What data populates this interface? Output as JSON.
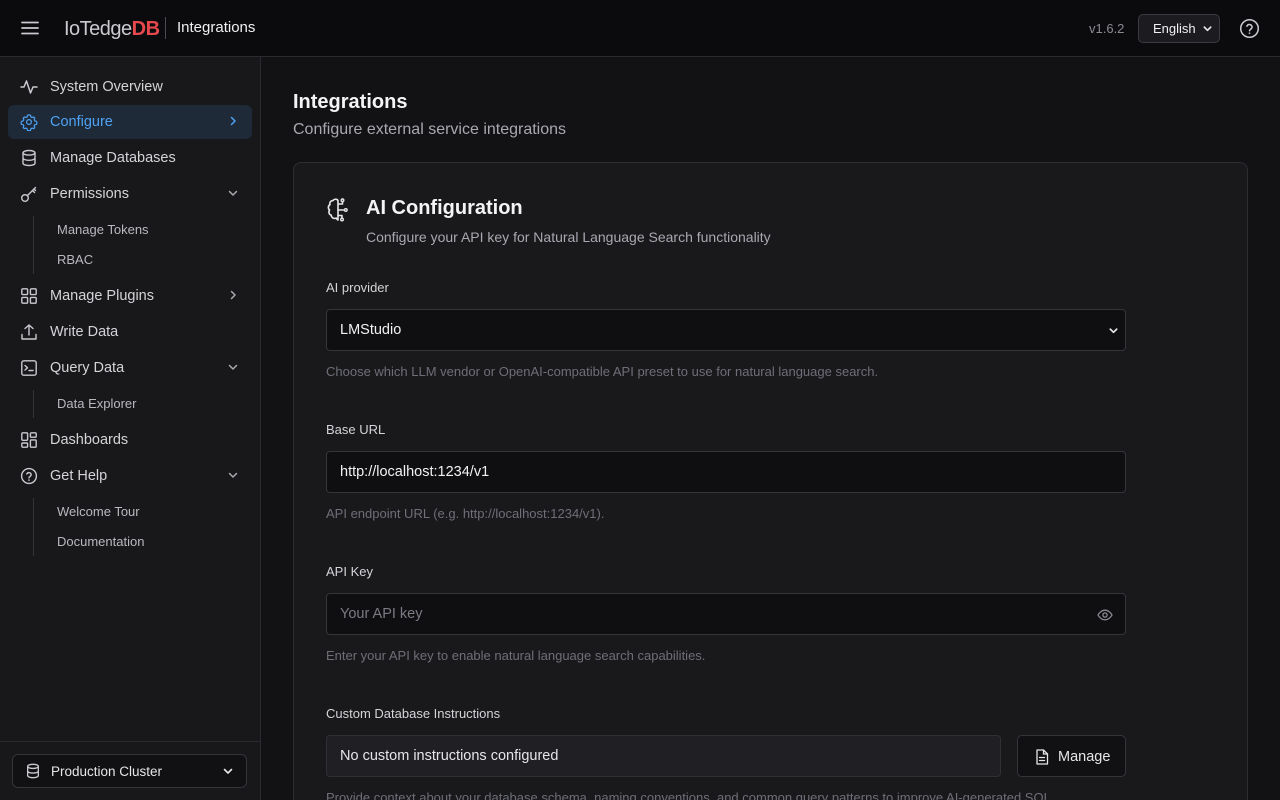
{
  "header": {
    "logo_part1": "IoTedge",
    "logo_part2": "DB",
    "title": "Integrations",
    "version": "v1.6.2",
    "language": "English"
  },
  "sidebar": {
    "items": [
      {
        "label": "System Overview",
        "icon": "activity-icon"
      },
      {
        "label": "Configure",
        "icon": "gear-icon",
        "active": true,
        "chevron": "right"
      },
      {
        "label": "Manage Databases",
        "icon": "database-icon"
      },
      {
        "label": "Permissions",
        "icon": "key-icon",
        "chevron": "down"
      },
      {
        "label": "Manage Plugins",
        "icon": "grid-icon",
        "chevron": "right"
      },
      {
        "label": "Write Data",
        "icon": "upload-icon"
      },
      {
        "label": "Query Data",
        "icon": "terminal-icon",
        "chevron": "down"
      },
      {
        "label": "Dashboards",
        "icon": "dashboard-icon"
      },
      {
        "label": "Get Help",
        "icon": "help-circle-icon",
        "chevron": "down"
      }
    ],
    "permissions_sub": [
      "Manage Tokens",
      "RBAC"
    ],
    "query_sub": [
      "Data Explorer"
    ],
    "help_sub": [
      "Welcome Tour",
      "Documentation"
    ],
    "cluster": "Production Cluster"
  },
  "main": {
    "title": "Integrations",
    "subtitle": "Configure external service integrations",
    "card": {
      "title": "AI Configuration",
      "subtitle": "Configure your API key for Natural Language Search functionality",
      "provider": {
        "label": "AI provider",
        "value": "LMStudio",
        "help": "Choose which LLM vendor or OpenAI-compatible API preset to use for natural language search."
      },
      "base_url": {
        "label": "Base URL",
        "value": "http://localhost:1234/v1",
        "help": "API endpoint URL (e.g. http://localhost:1234/v1)."
      },
      "api_key": {
        "label": "API Key",
        "placeholder": "Your API key",
        "help": "Enter your API key to enable natural language search capabilities."
      },
      "instructions": {
        "label": "Custom Database Instructions",
        "value": "No custom instructions configured",
        "button": "Manage",
        "help": "Provide context about your database schema, naming conventions, and common query patterns to improve AI-generated SQL."
      }
    }
  },
  "colors": {
    "accent": "#4ea1f3",
    "brand_red": "#e5484d",
    "active_bg": "#1f2a38"
  }
}
